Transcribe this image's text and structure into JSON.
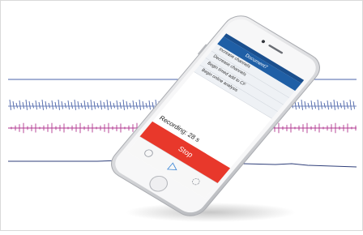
{
  "app": {
    "nav_title": "Document7",
    "menu_items": [
      "Increase channels",
      "Decrease channels",
      "Begin timed add to CF",
      "Begin online analysis"
    ],
    "recording_status": "Recording: 28 s",
    "stop_label": "Stop"
  },
  "colors": {
    "trace_blue": "#4a63a8",
    "trace_magenta": "#b0358f",
    "trace_navy": "#2f3f7a",
    "stop_red": "#e8382b",
    "navbar_blue": "#1f5fa6",
    "phone_silver": "#d9dadd"
  },
  "icons": [
    "record-tab-icon",
    "play-tab-icon",
    "settings-tab-icon",
    "home-button-icon"
  ]
}
